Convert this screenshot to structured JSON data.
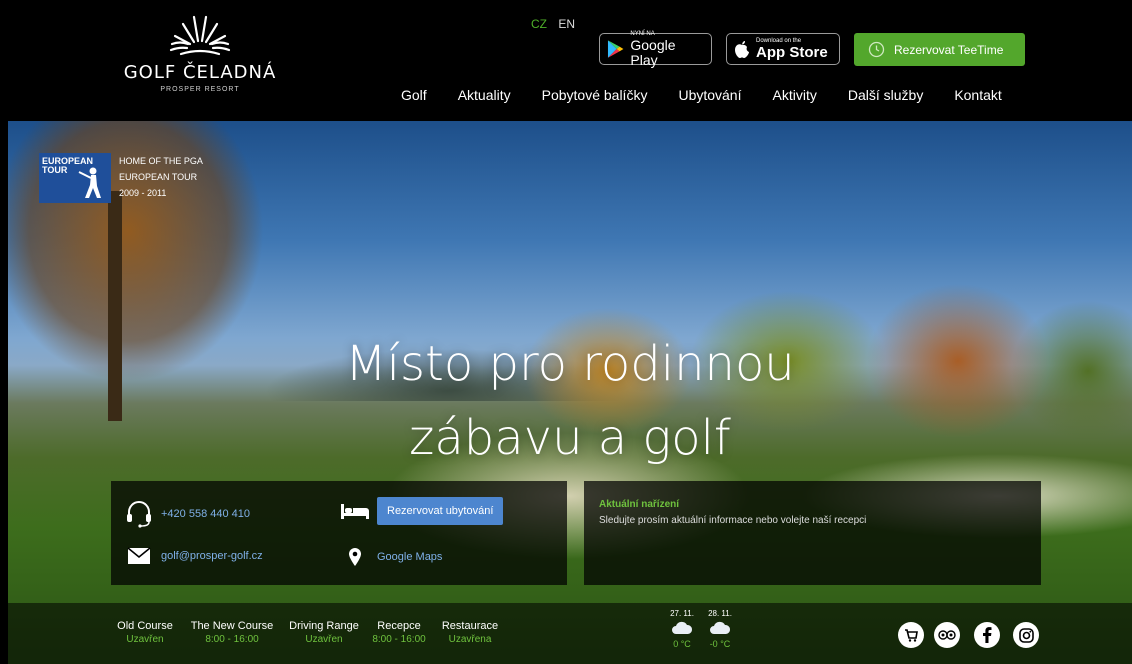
{
  "brand": {
    "name": "GOLF ČELADNÁ",
    "subtitle": "PROSPER RESORT"
  },
  "lang": {
    "active": "CZ",
    "other": "EN"
  },
  "stores": {
    "google_small": "NYNÍ NA",
    "google_big": "Google Play",
    "apple_small": "Download on the",
    "apple_big": "App Store"
  },
  "tee_button": "Rezervovat TeeTime",
  "nav": [
    "Golf",
    "Aktuality",
    "Pobytové balíčky",
    "Ubytování",
    "Aktivity",
    "Další služby",
    "Kontakt"
  ],
  "euro_tour": {
    "logo_line1": "EUROPEAN",
    "logo_line2": "TOUR",
    "text": [
      "HOME OF THE PGA",
      "EUROPEAN TOUR",
      "2009 - 2011"
    ]
  },
  "headline": [
    "Místo pro rodinnou",
    "zábavu a golf"
  ],
  "contact": {
    "phone": "+420 558 440 410",
    "email": "golf@prosper-golf.cz",
    "book_button": "Rezervovat ubytování",
    "maps": "Google Maps"
  },
  "notice": {
    "title": "Aktuální nařízení",
    "text": "Sledujte prosím aktuální informace nebo volejte naší recepci"
  },
  "status": [
    {
      "label": "Old Course",
      "value": "Uzavřen"
    },
    {
      "label": "The New Course",
      "value": "8:00 - 16:00"
    },
    {
      "label": "Driving Range",
      "value": "Uzavřen"
    },
    {
      "label": "Recepce",
      "value": "8:00 - 16:00"
    },
    {
      "label": "Restaurace",
      "value": "Uzavřena"
    }
  ],
  "weather": [
    {
      "date": "27. 11.",
      "temp": "0 °C",
      "icon": "cloud-icon"
    },
    {
      "date": "28. 11.",
      "temp": "-0 °C",
      "icon": "cloud-icon"
    }
  ],
  "colors": {
    "accent_green": "#53a72c",
    "link_blue": "#7fb0e8",
    "button_blue": "#4d86cf",
    "status_green": "#6fc23e"
  },
  "social_icons": [
    "cart-icon",
    "tripadvisor-icon",
    "facebook-icon",
    "instagram-icon"
  ]
}
